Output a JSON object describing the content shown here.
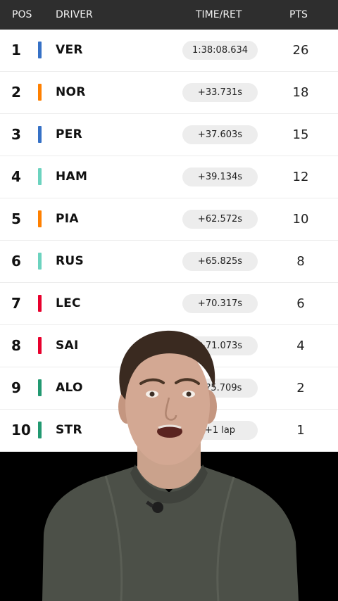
{
  "header": {
    "pos": "POS",
    "driver": "DRIVER",
    "time": "TIME/RET",
    "pts": "PTS"
  },
  "rows": [
    {
      "pos": "1",
      "driver": "VER",
      "time": "1:38:08.634",
      "pts": "26",
      "color": "#3671c6"
    },
    {
      "pos": "2",
      "driver": "NOR",
      "time": "+33.731s",
      "pts": "18",
      "color": "#ff8000"
    },
    {
      "pos": "3",
      "driver": "PER",
      "time": "+37.603s",
      "pts": "15",
      "color": "#3671c6"
    },
    {
      "pos": "4",
      "driver": "HAM",
      "time": "+39.134s",
      "pts": "12",
      "color": "#6cd3bf"
    },
    {
      "pos": "5",
      "driver": "PIA",
      "time": "+62.572s",
      "pts": "10",
      "color": "#ff8000"
    },
    {
      "pos": "6",
      "driver": "RUS",
      "time": "+65.825s",
      "pts": "8",
      "color": "#6cd3bf"
    },
    {
      "pos": "7",
      "driver": "LEC",
      "time": "+70.317s",
      "pts": "6",
      "color": "#e8002d"
    },
    {
      "pos": "8",
      "driver": "SAI",
      "time": "+71.073s",
      "pts": "4",
      "color": "#e8002d"
    },
    {
      "pos": "9",
      "driver": "ALO",
      "time": "+?5.709s",
      "pts": "2",
      "color": "#229971"
    },
    {
      "pos": "10",
      "driver": "STR",
      "time": "+1 lap",
      "pts": "1",
      "color": "#229971"
    }
  ]
}
